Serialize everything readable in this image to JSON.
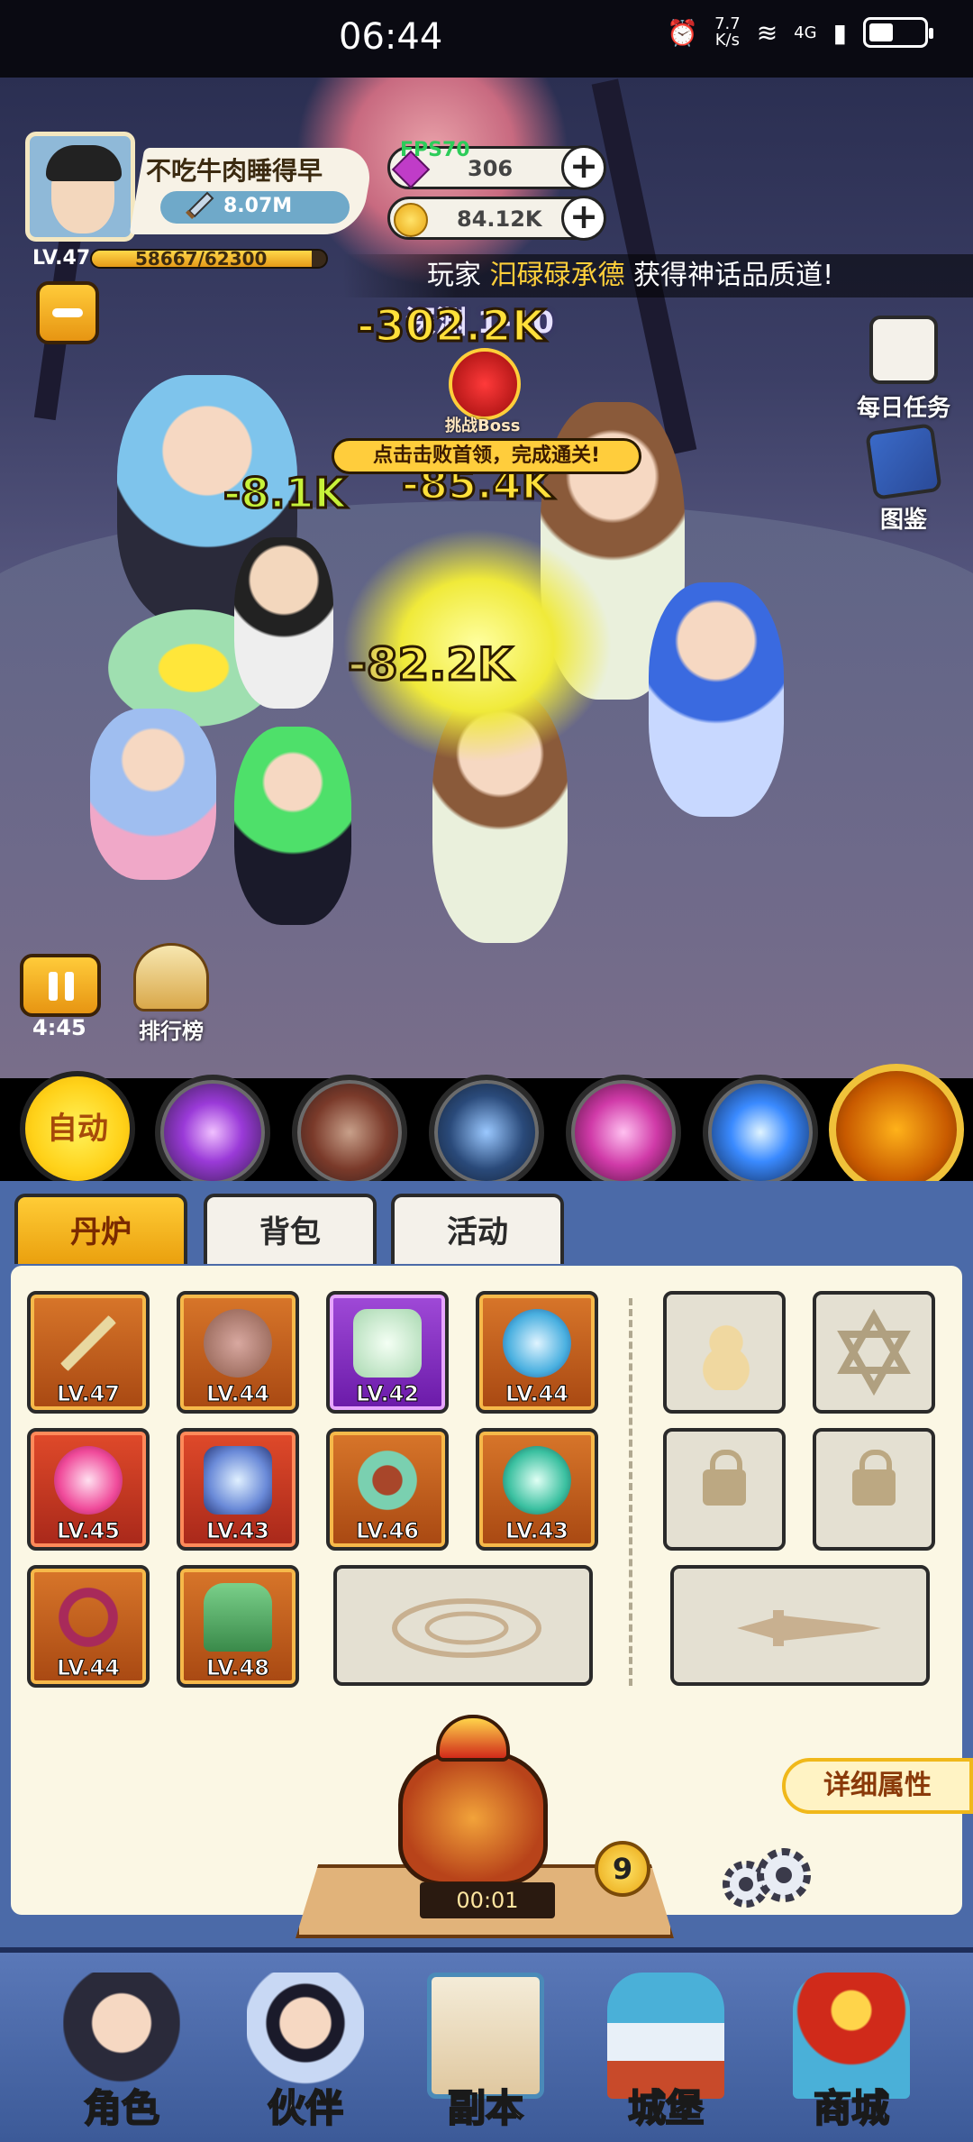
{
  "status_bar": {
    "time": "06:44",
    "net_speed_value": "7.7",
    "net_speed_unit": "K/s",
    "network_type": "4G"
  },
  "player": {
    "name": "不吃牛肉睡得早",
    "power": "8.07M",
    "level": "LV.47",
    "exp": "58667/62300",
    "exp_fraction": 0.94
  },
  "currency": {
    "gems": "306",
    "gems_overlay": "FPS70",
    "gold": "84.12K"
  },
  "announcement": {
    "prefix": "玩家",
    "player": "汩碌碌承德",
    "suffix": "获得神话品质道!"
  },
  "stage": {
    "label": "深渊 1-10",
    "boss_label": "挑战Boss",
    "boss_tip": "点击击败首领，完成通关!"
  },
  "damage_numbers": [
    "-302.2K",
    "-8.1K",
    "-85.4K",
    "-82.2K"
  ],
  "side_buttons": {
    "daily_tasks": "每日任务",
    "codex": "图鉴"
  },
  "battle_controls": {
    "timer": "4:45",
    "ranking_label": "排行榜"
  },
  "skill_bar": {
    "auto_label": "自动",
    "skills": [
      "purple-orb-skill",
      "beast-skill",
      "lightning-shield-skill",
      "vortex-skill",
      "blue-fireball-skill"
    ],
    "ultimate": "fire-demon-ultimate"
  },
  "tabs": [
    {
      "label": "丹炉",
      "active": true
    },
    {
      "label": "背包",
      "active": false
    },
    {
      "label": "活动",
      "active": false
    }
  ],
  "equipment": [
    {
      "name": "spear-icon",
      "level": "LV.47",
      "rarity": "orange"
    },
    {
      "name": "crown-icon",
      "level": "LV.44",
      "rarity": "orange"
    },
    {
      "name": "robe-icon",
      "level": "LV.42",
      "rarity": "purple"
    },
    {
      "name": "crane-orb-icon",
      "level": "LV.44",
      "rarity": "orange"
    },
    {
      "name": "pink-pearl-icon",
      "level": "LV.45",
      "rarity": "red"
    },
    {
      "name": "bagua-icon",
      "level": "LV.43",
      "rarity": "red"
    },
    {
      "name": "jade-bracelet-icon",
      "level": "LV.46",
      "rarity": "orange"
    },
    {
      "name": "spirit-orb-icon",
      "level": "LV.43",
      "rarity": "orange"
    },
    {
      "name": "belt-icon",
      "level": "LV.44",
      "rarity": "orange"
    },
    {
      "name": "boots-icon",
      "level": "LV.48",
      "rarity": "orange"
    }
  ],
  "furnace": {
    "timer": "00:01",
    "level": "9",
    "detail_label": "详细属性"
  },
  "bottom_nav": [
    {
      "label": "角色",
      "icon": "character-icon"
    },
    {
      "label": "伙伴",
      "icon": "partner-icon"
    },
    {
      "label": "副本",
      "icon": "dungeon-scroll-icon"
    },
    {
      "label": "城堡",
      "icon": "castle-icon"
    },
    {
      "label": "商城",
      "icon": "shop-icon"
    }
  ],
  "colors": {
    "accent_gold": "#ffcd3c",
    "panel_blue": "#4b6aa8",
    "panel_cream": "#fbf7e4"
  }
}
